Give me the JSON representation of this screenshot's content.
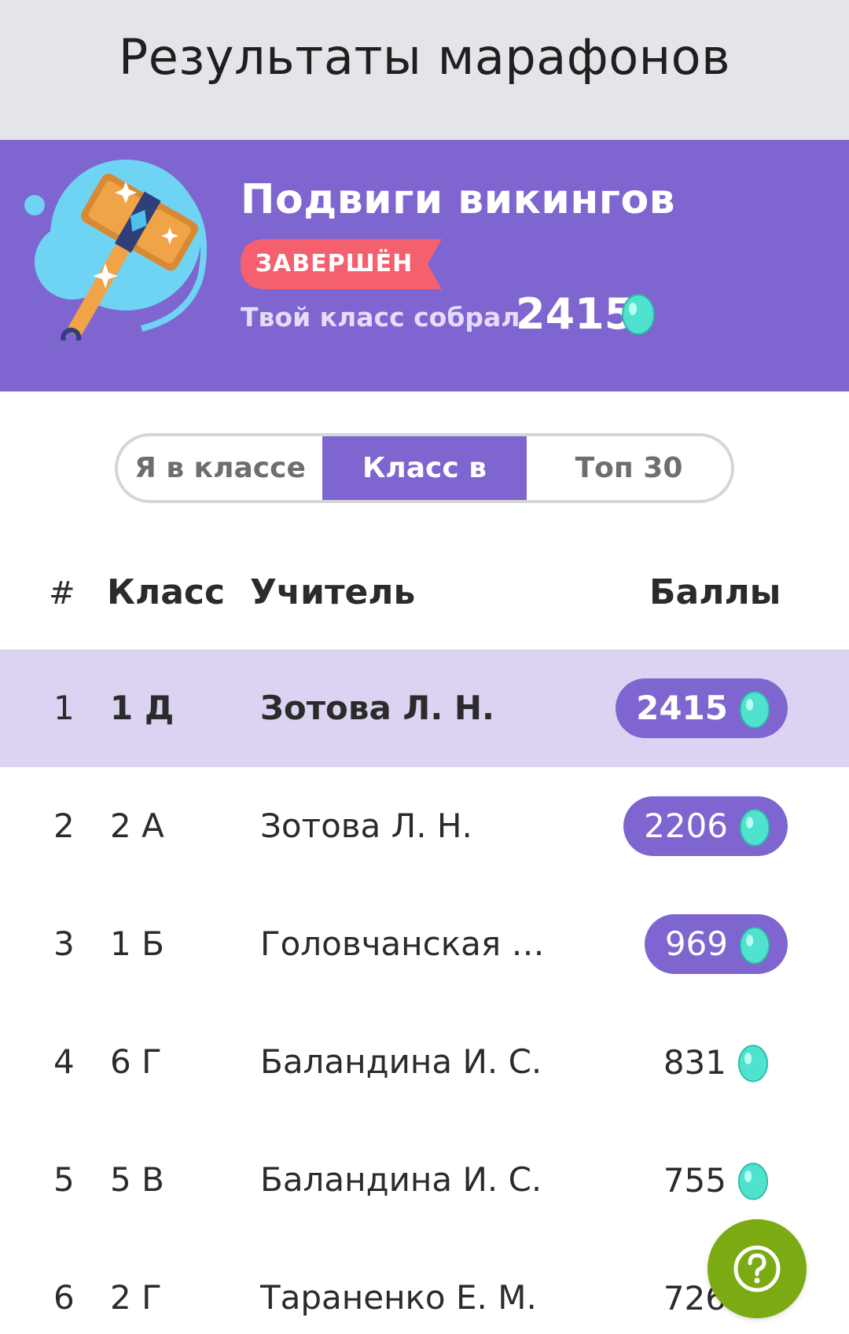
{
  "header": {
    "title": "Результаты марафонов"
  },
  "marathon": {
    "title": "Подвиги викингов",
    "status": "ЗАВЕРШЁН",
    "collected_label": "Твой класс собрал",
    "collected_value": "2415",
    "icon": "viking-hammer-illustration"
  },
  "tabs": [
    {
      "label": "Я в классе",
      "active": false
    },
    {
      "label": "Класс в",
      "active": true
    },
    {
      "label": "Топ 30",
      "active": false
    }
  ],
  "table": {
    "headers": {
      "rank": "#",
      "class": "Класс",
      "teacher": "Учитель",
      "score": "Баллы"
    },
    "rows": [
      {
        "rank": "1",
        "class": "1 Д",
        "teacher": "Зотова Л. Н.",
        "score": "2415",
        "highlight": true
      },
      {
        "rank": "2",
        "class": "2 А",
        "teacher": "Зотова Л. Н.",
        "score": "2206"
      },
      {
        "rank": "3",
        "class": "1 Б",
        "teacher": "Головчанская Л...",
        "score": "969"
      },
      {
        "rank": "4",
        "class": "6 Г",
        "teacher": "Баландина И. С.",
        "score": "831"
      },
      {
        "rank": "5",
        "class": "5 В",
        "teacher": "Баландина И. С.",
        "score": "755"
      },
      {
        "rank": "6",
        "class": "2 Г",
        "teacher": "Тараненко Е. М.",
        "score": "726"
      }
    ]
  },
  "score_icon": "egg-gem-icon",
  "help_button": {
    "icon": "question-icon"
  },
  "colors": {
    "accent": "#7e65d0",
    "highlight_row": "#dcd3f3",
    "status_ribbon": "#f4606e",
    "egg": "#4fe3cf",
    "help": "#7caa12",
    "header_bg": "#e4e5e8"
  }
}
